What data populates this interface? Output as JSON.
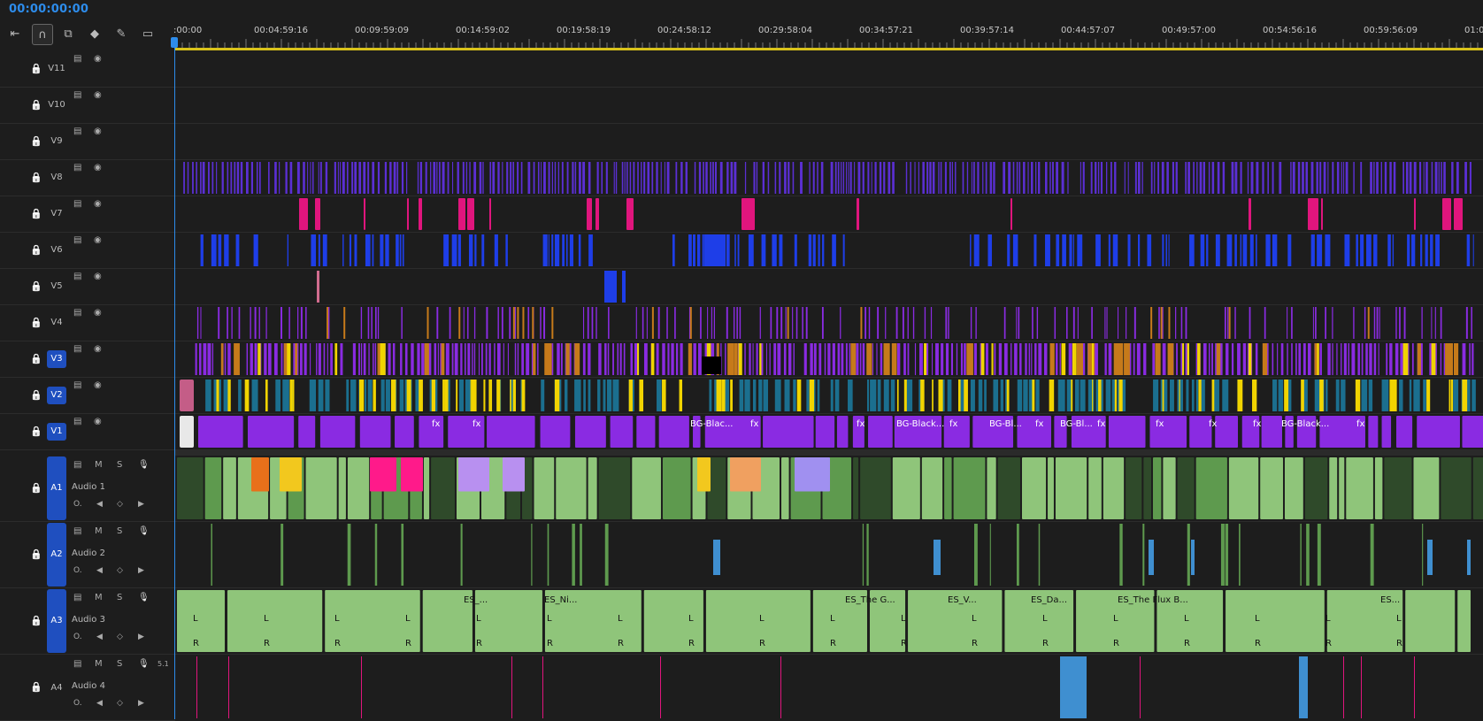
{
  "timecode": "00:00:00:00",
  "toolbar": {
    "tools": [
      {
        "name": "insert-sequence-icon",
        "glyph": "⇤"
      },
      {
        "name": "snap-magnet-icon",
        "glyph": "∩",
        "active": true
      },
      {
        "name": "linked-selection-icon",
        "glyph": "⧉"
      },
      {
        "name": "add-marker-icon",
        "glyph": "◆"
      },
      {
        "name": "wrench-settings-icon",
        "glyph": "✎"
      },
      {
        "name": "captions-icon",
        "glyph": "▭"
      }
    ]
  },
  "ruler": {
    "labels": [
      ":00:00",
      "00:04:59:16",
      "00:09:59:09",
      "00:14:59:02",
      "00:19:58:19",
      "00:24:58:12",
      "00:29:58:04",
      "00:34:57:21",
      "00:39:57:14",
      "00:44:57:07",
      "00:49:57:00",
      "00:54:56:16",
      "00:59:56:09",
      "01:0"
    ]
  },
  "video_tracks": [
    {
      "name": "V11",
      "target": false
    },
    {
      "name": "V10",
      "target": false
    },
    {
      "name": "V9",
      "target": false
    },
    {
      "name": "V8",
      "target": false
    },
    {
      "name": "V7",
      "target": false
    },
    {
      "name": "V6",
      "target": false
    },
    {
      "name": "V5",
      "target": false
    },
    {
      "name": "V4",
      "target": false
    },
    {
      "name": "V3",
      "target": true
    },
    {
      "name": "V2",
      "target": true
    },
    {
      "name": "V1",
      "target": true
    }
  ],
  "audio_tracks": [
    {
      "id": "A1",
      "name": "Audio 1",
      "target": true,
      "m": "M",
      "s": "S"
    },
    {
      "id": "A2",
      "name": "Audio 2",
      "target": true,
      "m": "M",
      "s": "S"
    },
    {
      "id": "A3",
      "name": "Audio 3",
      "target": true,
      "m": "M",
      "s": "S"
    },
    {
      "id": "A4",
      "name": "Audio 4",
      "target": false,
      "m": "M",
      "s": "S",
      "extra": "5.1"
    }
  ],
  "clip_labels": {
    "v1": [
      "fx",
      "fx",
      "BG-Blac...",
      "fx",
      "fx",
      "BG-Black...",
      "fx",
      "BG-Bl...",
      "fx",
      "BG-Bl...",
      "fx",
      "fx",
      "fx",
      "fx",
      "BG-Black...",
      "fx"
    ],
    "a3": [
      "ES_...",
      "ES_Ni...",
      "ES_The G...",
      "ES_V...",
      "ES_Da...",
      "ES_The Flux B...",
      "ES..."
    ],
    "audio_badges": [
      "L",
      "R",
      "fx"
    ]
  },
  "colors": {
    "accent": "#2d8ceb",
    "purple": "#8a2be2",
    "violet": "#5b2fd4",
    "magenta": "#e0157d",
    "blue": "#1e3ee8",
    "yellow": "#f1d400",
    "orange": "#c67a1a",
    "teal": "#1b6f8f",
    "green_audio": "#8fc57a",
    "green_audio_dark": "#5e9a4e",
    "dark_green": "#2f4a2a",
    "track_target": "#1f4fbf"
  }
}
